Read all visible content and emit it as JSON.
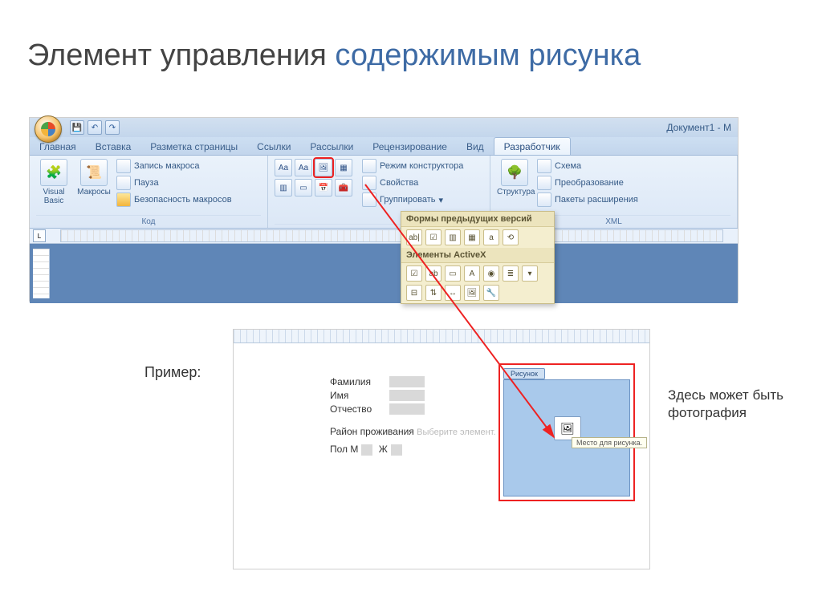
{
  "slide": {
    "title_plain": "Элемент управления ",
    "title_accent": "содержимым рисунка"
  },
  "word": {
    "qat": {
      "doc_title": "Документ1 - M"
    },
    "tabs": {
      "t0": "Главная",
      "t1": "Вставка",
      "t2": "Разметка страницы",
      "t3": "Ссылки",
      "t4": "Рассылки",
      "t5": "Рецензирование",
      "t6": "Вид",
      "t7": "Разработчик"
    },
    "groups": {
      "code": {
        "vb": "Visual\nBasic",
        "macros": "Макросы",
        "rec": "Запись макроса",
        "pause": "Пауза",
        "sec": "Безопасность макросов",
        "label": "Код"
      },
      "controls": {
        "designmode": "Режим конструктора",
        "props": "Свойства",
        "group": "Группировать",
        "label": ""
      },
      "structure": {
        "struct": "Структура",
        "schema": "Схема",
        "transform": "Преобразование",
        "packs": "Пакеты расширения",
        "label": "XML"
      }
    },
    "dropdown": {
      "hdr1": "Формы предыдущих версий",
      "hdr2": "Элементы ActiveX"
    }
  },
  "example": {
    "label": "Пример:",
    "fields": {
      "famil": "Фамилия",
      "imya": "Имя",
      "otch": "Отчество",
      "rayon": "Район проживания",
      "rayon_placeholder": "Выберите элемент.",
      "pol": "Пол",
      "pol_m": "М",
      "pol_zh": "Ж"
    },
    "picture": {
      "tab": "Рисунок",
      "tip": "Место для рисунка."
    },
    "side_note": "Здесь может быть фотография"
  }
}
